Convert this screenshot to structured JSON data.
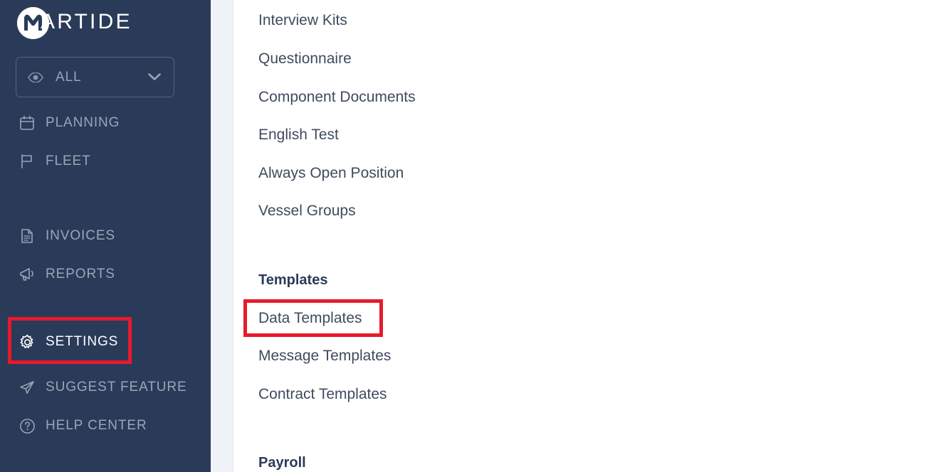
{
  "brand": {
    "logo_letter": "M",
    "name": "ARTIDE",
    "navy": "#2a3b59",
    "accent_red": "#e8192c"
  },
  "sidebar": {
    "scope_select": {
      "icon": "eye-icon",
      "value": "ALL",
      "chevron": "chevron-down-icon"
    },
    "nav_top": [
      {
        "label": "PLANNING",
        "icon": "calendar-icon"
      },
      {
        "label": "FLEET",
        "icon": "flag-icon"
      }
    ],
    "nav_mid": [
      {
        "label": "INVOICES",
        "icon": "document-icon"
      },
      {
        "label": "REPORTS",
        "icon": "megaphone-icon"
      }
    ],
    "settings": {
      "label": "SETTINGS",
      "icon": "gear-icon",
      "active": true
    },
    "nav_bottom": [
      {
        "label": "SUGGEST FEATURE",
        "icon": "paper-plane-icon"
      },
      {
        "label": "HELP CENTER",
        "icon": "question-circle-icon"
      }
    ]
  },
  "content": {
    "items_top": [
      "Interview Kits",
      "Questionnaire",
      "Component Documents",
      "English Test",
      "Always Open Position",
      "Vessel Groups"
    ],
    "templates_heading": "Templates",
    "templates_items": [
      "Data Templates",
      "Message Templates",
      "Contract Templates"
    ],
    "payroll_heading": "Payroll"
  },
  "annotations": [
    {
      "target": "SETTINGS",
      "color": "#e8192c"
    },
    {
      "target": "Data Templates",
      "color": "#e8192c"
    }
  ]
}
